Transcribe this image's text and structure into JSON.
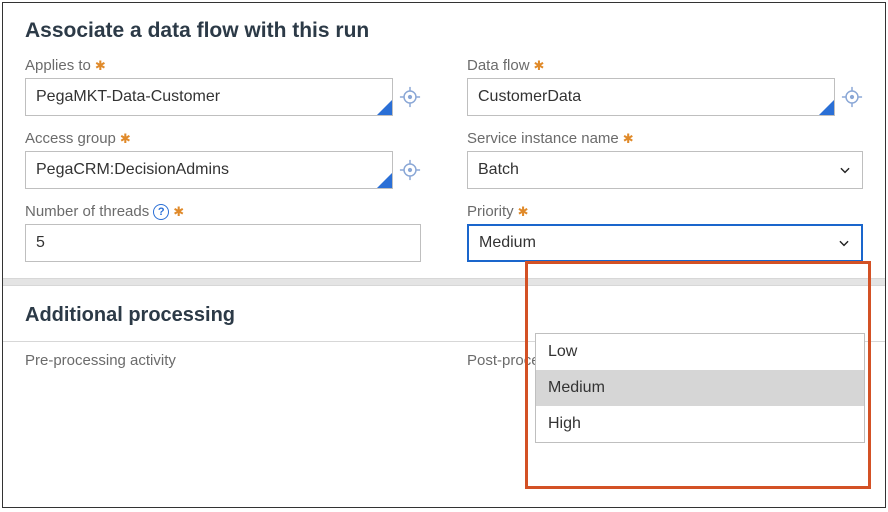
{
  "section1_title": "Associate a data flow with this run",
  "section2_title": "Additional processing",
  "fields": {
    "applies_to": {
      "label": "Applies to",
      "value": "PegaMKT-Data-Customer"
    },
    "data_flow": {
      "label": "Data flow",
      "value": "CustomerData"
    },
    "access_group": {
      "label": "Access group",
      "value": "PegaCRM:DecisionAdmins"
    },
    "service_instance": {
      "label": "Service instance name",
      "value": "Batch"
    },
    "threads": {
      "label": "Number of threads",
      "value": "5"
    },
    "priority": {
      "label": "Priority",
      "value": "Medium",
      "options": [
        "Low",
        "Medium",
        "High"
      ]
    }
  },
  "bottom": {
    "pre": "Pre-processing activity",
    "post": "Post-processing activity"
  }
}
